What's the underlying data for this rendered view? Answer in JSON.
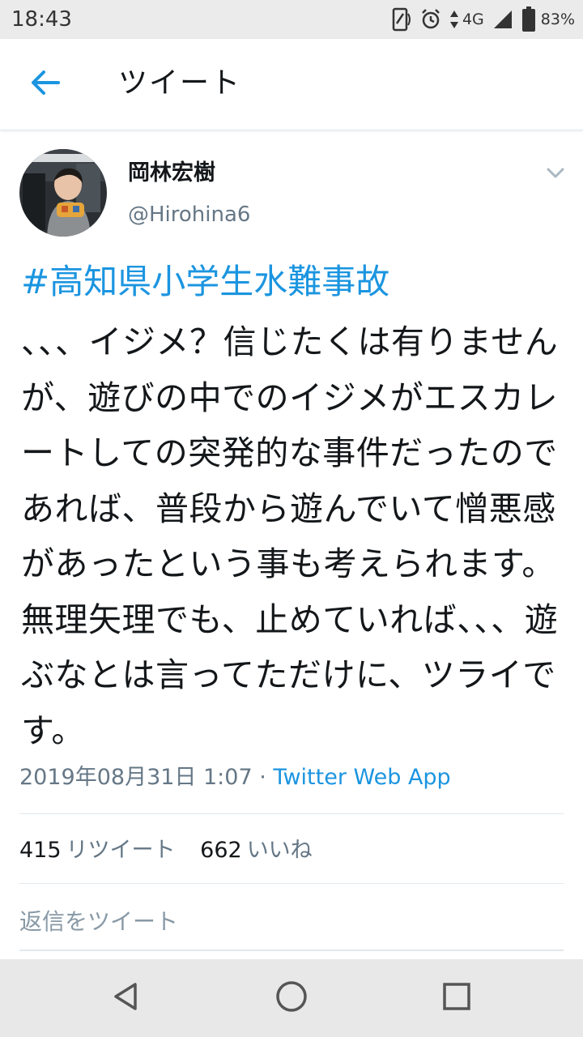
{
  "status_bar": {
    "time": "18:43",
    "network": "4G",
    "battery": "83%",
    "icons": [
      "screen-rotate-icon",
      "alarm-icon",
      "data-arrows-icon",
      "signal-icon",
      "battery-icon"
    ]
  },
  "app_bar": {
    "back_icon": "arrow-left-icon",
    "title": "ツイート"
  },
  "tweet": {
    "author": {
      "display_name": "岡林宏樹",
      "handle": "@Hirohina6",
      "avatar": "avatar-photo"
    },
    "hashtag": "#高知県小学生水難事故",
    "text": "、、、イジメ？信じたくは有りませんが、遊びの中でのイジメがエスカレートしての突発的な事件だったのであれば、普段から遊んでいて憎悪感があったという事も考えられます。無理矢理でも、止めていれば、、、遊ぶなとは言ってただけに、ツライです。",
    "timestamp": "2019年08月31日 1:07",
    "separator": "·",
    "source": "Twitter Web App",
    "retweets": {
      "count": "415",
      "label": "リツイート"
    },
    "likes": {
      "count": "662",
      "label": "いいね"
    }
  },
  "reply": {
    "placeholder": "返信をツイート"
  },
  "colors": {
    "accent": "#1b95e0",
    "text": "#14171a",
    "secondary": "#657786",
    "divider": "#e1e8ed"
  }
}
